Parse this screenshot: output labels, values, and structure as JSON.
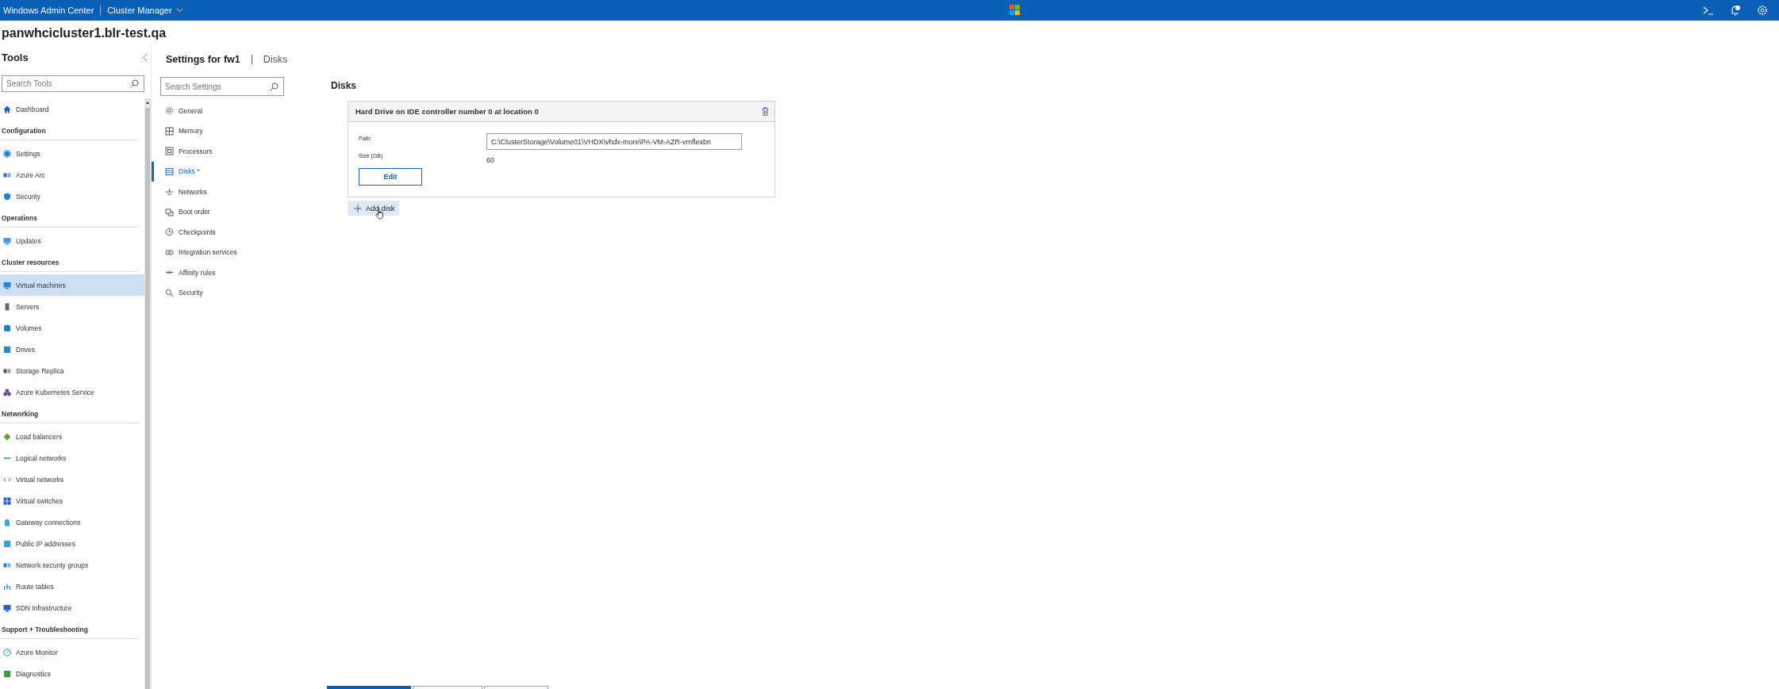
{
  "app": {
    "title": "Windows Admin Center",
    "context": "Cluster Manager"
  },
  "cluster": "panwhcicluster1.blr-test.qa",
  "tools": {
    "title": "Tools",
    "search": {
      "placeholder": "Search Tools"
    },
    "groups": [
      {
        "items": [
          {
            "label": "Dashboard",
            "selected": false
          }
        ]
      },
      {
        "heading": "Configuration",
        "items": [
          {
            "label": "Settings",
            "selected": false
          },
          {
            "label": "Azure Arc",
            "selected": false
          },
          {
            "label": "Security",
            "selected": false
          }
        ]
      },
      {
        "heading": "Operations",
        "items": [
          {
            "label": "Updates",
            "selected": false
          }
        ]
      },
      {
        "heading": "Cluster resources",
        "items": [
          {
            "label": "Virtual machines",
            "selected": true
          },
          {
            "label": "Servers",
            "selected": false
          },
          {
            "label": "Volumes",
            "selected": false
          },
          {
            "label": "Drives",
            "selected": false
          },
          {
            "label": "Storage Replica",
            "selected": false
          },
          {
            "label": "Azure Kubernetes Service",
            "selected": false
          }
        ]
      },
      {
        "heading": "Networking",
        "items": [
          {
            "label": "Load balancers",
            "selected": false
          },
          {
            "label": "Logical networks",
            "selected": false
          },
          {
            "label": "Virtual networks",
            "selected": false
          },
          {
            "label": "Virtual switches",
            "selected": false
          },
          {
            "label": "Gateway connections",
            "selected": false
          },
          {
            "label": "Public IP addresses",
            "selected": false
          },
          {
            "label": "Network security groups",
            "selected": false
          },
          {
            "label": "Route tables",
            "selected": false
          },
          {
            "label": "SDN Infrastructure",
            "selected": false
          }
        ]
      },
      {
        "heading": "Support + Troubleshooting",
        "items": [
          {
            "label": "Azure Monitor",
            "selected": false
          },
          {
            "label": "Diagnostics",
            "selected": false
          }
        ]
      }
    ]
  },
  "settings": {
    "title": "Settings for fw1",
    "crumb": "Disks",
    "search": {
      "placeholder": "Search Settings"
    },
    "items": [
      {
        "label": "General",
        "selected": false
      },
      {
        "label": "Memory",
        "selected": false
      },
      {
        "label": "Processors",
        "selected": false
      },
      {
        "label": "Disks *",
        "selected": true
      },
      {
        "label": "Networks",
        "selected": false
      },
      {
        "label": "Boot order",
        "selected": false
      },
      {
        "label": "Checkpoints",
        "selected": false
      },
      {
        "label": "Integration services",
        "selected": false
      },
      {
        "label": "Affinity rules",
        "selected": false
      },
      {
        "label": "Security",
        "selected": false
      }
    ]
  },
  "disks": {
    "title": "Disks",
    "cards": [
      {
        "title": "Hard Drive on IDE controller number 0 at location 0",
        "path_label": "Path:",
        "path": "C:\\ClusterStorage\\Volume01\\VHDX\\vhdx-more\\PA-VM-AZR-vmflexbn",
        "size_label": "Size (GB)",
        "size": "60",
        "edit": "Edit"
      }
    ],
    "add": "Add disk"
  }
}
